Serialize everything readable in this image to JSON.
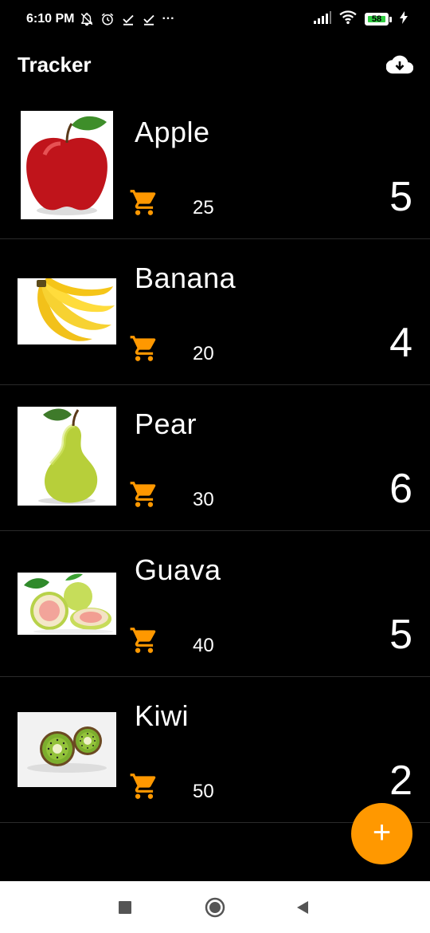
{
  "status_bar": {
    "time": "6:10 PM",
    "more": "···",
    "battery_level": "58"
  },
  "app_bar": {
    "title": "Tracker"
  },
  "accent_color": "#ff9800",
  "items": [
    {
      "name": "Apple",
      "price": "25",
      "quantity": "5"
    },
    {
      "name": "Banana",
      "price": "20",
      "quantity": "4"
    },
    {
      "name": "Pear",
      "price": "30",
      "quantity": "6"
    },
    {
      "name": "Guava",
      "price": "40",
      "quantity": "5"
    },
    {
      "name": "Kiwi",
      "price": "50",
      "quantity": "2"
    }
  ],
  "fab": {
    "label": "+"
  },
  "icons": {
    "status": [
      "notifications-off-icon",
      "alarm-icon",
      "download-done-icon",
      "download-done-icon",
      "signal-icon",
      "wifi-icon",
      "battery-icon",
      "charging-icon"
    ],
    "app_bar": "cloud-download-icon",
    "row": "shopping-cart-icon",
    "nav": [
      "recents-square-icon",
      "home-circle-icon",
      "back-triangle-icon"
    ]
  }
}
